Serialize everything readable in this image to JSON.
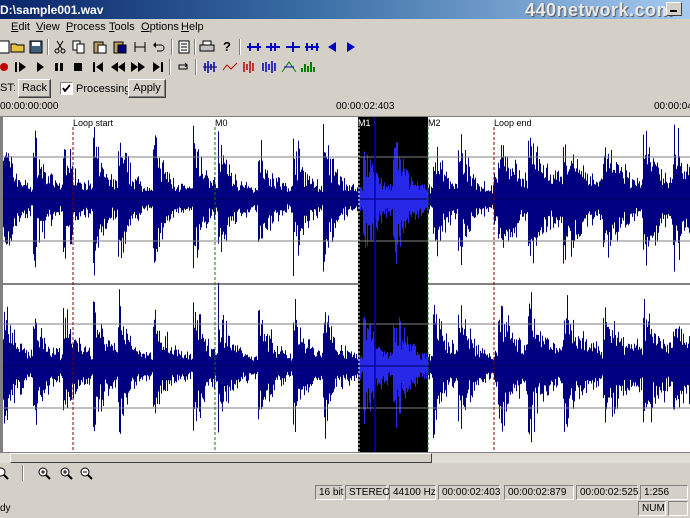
{
  "window": {
    "title": "D:\\sample001.wav",
    "watermark": "440network.com"
  },
  "menu": {
    "items": [
      {
        "label": "Edit",
        "key": "E",
        "rest": "dit"
      },
      {
        "label": "View",
        "key": "V",
        "rest": "iew"
      },
      {
        "label": "Process",
        "key": "P",
        "rest": "rocess"
      },
      {
        "label": "Tools",
        "key": "T",
        "rest": "ools"
      },
      {
        "label": "Options",
        "key": "O",
        "rest": "ptions"
      },
      {
        "label": "Help",
        "key": "H",
        "rest": "elp"
      }
    ]
  },
  "toolbar3": {
    "prefix": "ST:",
    "rack_label": "Rack",
    "processing_label": "Processing",
    "processing_checked": true,
    "apply_label": "Apply"
  },
  "ruler": {
    "start": "00:00:00:000",
    "mid": "00:00:02:403",
    "end": "00:00:04"
  },
  "markers": {
    "loop_start": "Loop start",
    "m0": "M0",
    "m1": "M1",
    "m2": "M2",
    "loop_end": "Loop end"
  },
  "status": {
    "left": "dy",
    "bit_depth": "16 bit",
    "channels": "STEREO",
    "sample_rate": "44100 Hz",
    "sel_start": "00:00:02:403",
    "sel_end": "00:00:02:879",
    "sel_length": "00:00:02:525",
    "zoom": "1:256",
    "num": "NUM"
  },
  "colors": {
    "waveform": "#000080",
    "selection_bg": "#000000",
    "selection_wave": "#2828e8",
    "loop_marker": "#800000",
    "m0_marker": "#008000"
  }
}
